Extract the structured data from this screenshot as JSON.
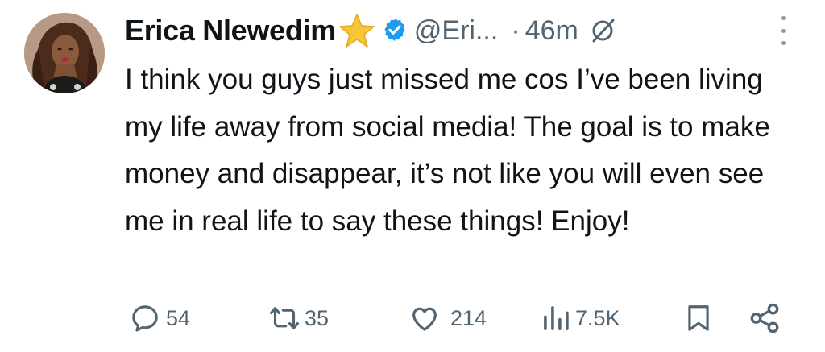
{
  "tweet": {
    "author_name": "Erica Nlewedim",
    "handle": "@Eri...",
    "separator": "·",
    "time": "46m",
    "text": "I think you guys just missed me cos I’ve been living my life away from social media! The goal is to make money and disappear, it’s not like you will even see me in real life to say these things! Enjoy!"
  },
  "icons": {
    "star": "star-emoji-icon",
    "verified": "verified-badge-icon",
    "mute": "muted-notifications-icon",
    "more": "more-options-icon",
    "reply": "reply-icon",
    "retweet": "retweet-icon",
    "like": "like-icon",
    "views": "views-icon",
    "bookmark": "bookmark-icon",
    "share": "share-icon"
  },
  "metrics": {
    "replies": "54",
    "retweets": "35",
    "likes": "214",
    "views": "7.5K"
  },
  "colors": {
    "verified_blue": "#1d9bf0",
    "star_yellow": "#f6c636",
    "muted_gray": "#536471",
    "text": "#0f1419"
  }
}
